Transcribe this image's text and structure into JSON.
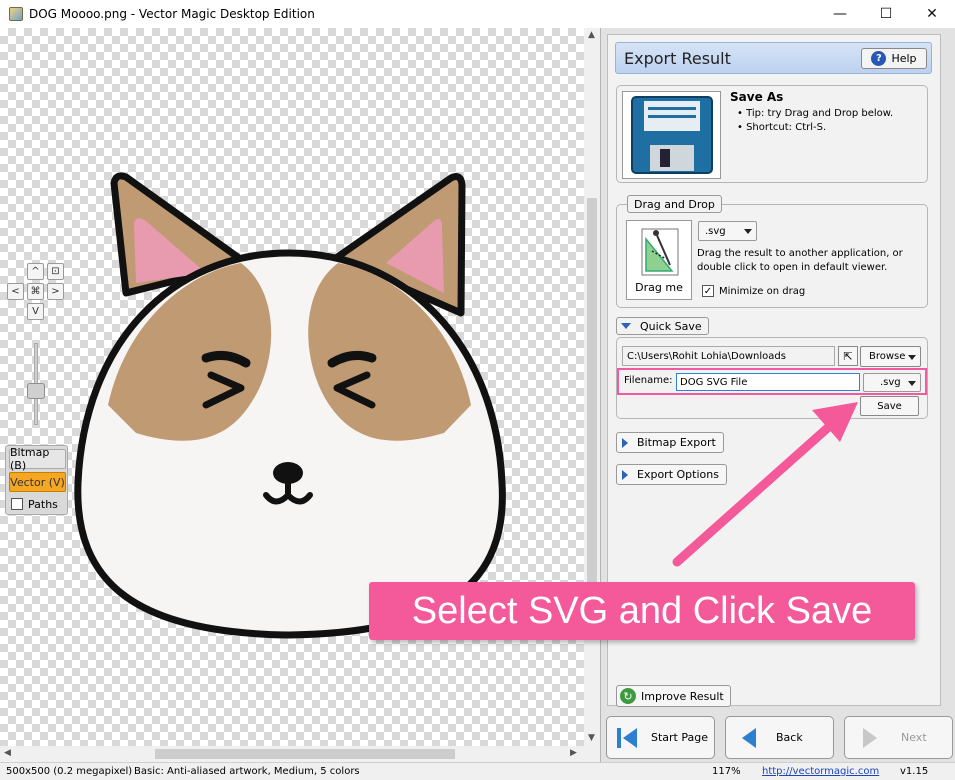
{
  "window": {
    "title": "DOG Moooo.png - Vector Magic Desktop Edition",
    "minimize": "—",
    "maximize": "☐",
    "close": "✕"
  },
  "view_controls": {
    "up": "^",
    "fit": "⊡",
    "left": "<",
    "center": "⌘",
    "right": ">",
    "down": "V",
    "modes": {
      "bitmap": "Bitmap (B)",
      "vector": "Vector (V)",
      "paths": "Paths"
    }
  },
  "panel": {
    "title": "Export Result",
    "help": "Help",
    "save_as": {
      "title": "Save As",
      "tip1": "• Tip: try Drag and Drop below.",
      "tip2": "• Shortcut: Ctrl-S."
    },
    "drag_drop": {
      "label": "Drag and Drop",
      "drag_me": "Drag me",
      "format": ".svg",
      "desc1": "Drag the result to another application, or",
      "desc2": "double click to open in default viewer.",
      "minimize": "Minimize on drag",
      "minimize_checked": "✓"
    },
    "quick_save": {
      "label": "Quick Save",
      "path": "C:\\Users\\Rohit Lohia\\Downloads",
      "browse": "Browse",
      "filename_label": "Filename:",
      "filename_value": "DOG SVG File",
      "format": ".svg",
      "save": "Save"
    },
    "bitmap_export": "Bitmap Export",
    "export_options": "Export Options",
    "improve_result": "Improve Result",
    "nav": {
      "start": "Start Page",
      "back": "Back",
      "next": "Next"
    }
  },
  "status": {
    "size": "500x500 (0.2 megapixel)",
    "settings": "Basic: Anti-aliased artwork, Medium, 5 colors",
    "zoom": "117%",
    "url": "http://vectormagic.com",
    "version": "v1.15"
  },
  "annotation": {
    "text": "Select SVG and Click Save",
    "color": "#f4599a"
  },
  "colors": {
    "accent_vector": "#f5a623",
    "header_blue": "#bcd1ef",
    "highlight": "#f25aa0"
  }
}
